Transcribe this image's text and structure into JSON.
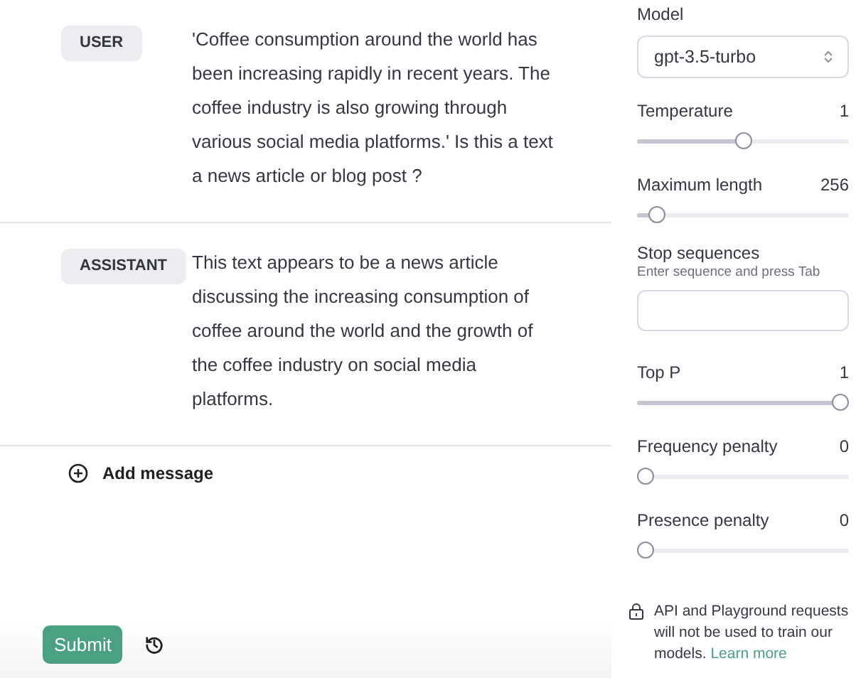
{
  "messages": [
    {
      "role": "USER",
      "text": "'Coffee consumption around the world has been increasing rapidly in recent years. The coffee industry is also growing through various social media platforms.' Is this a text a news article or blog post ?"
    },
    {
      "role": "ASSISTANT",
      "text": "This text appears to be a news article discussing the increasing consumption of coffee around the world and the growth of the coffee industry on social media platforms."
    }
  ],
  "add_message": "Add message",
  "submit": "Submit",
  "settings": {
    "model_label": "Model",
    "model": "gpt-3.5-turbo",
    "sliders_top": [
      {
        "label": "Temperature",
        "value": "1",
        "level": 0.5
      },
      {
        "label": "Maximum length",
        "value": "256",
        "level": 0.06
      }
    ],
    "stop": {
      "label": "Stop sequences",
      "hint": "Enter sequence and press Tab"
    },
    "sliders_bottom": [
      {
        "label": "Top P",
        "value": "1",
        "level": 1
      },
      {
        "label": "Frequency penalty",
        "value": "0",
        "level": 0
      },
      {
        "label": "Presence penalty",
        "value": "0",
        "level": 0
      }
    ],
    "notice": "API and Playground requests will not be used to train our models.",
    "notice_link": "Learn more"
  }
}
